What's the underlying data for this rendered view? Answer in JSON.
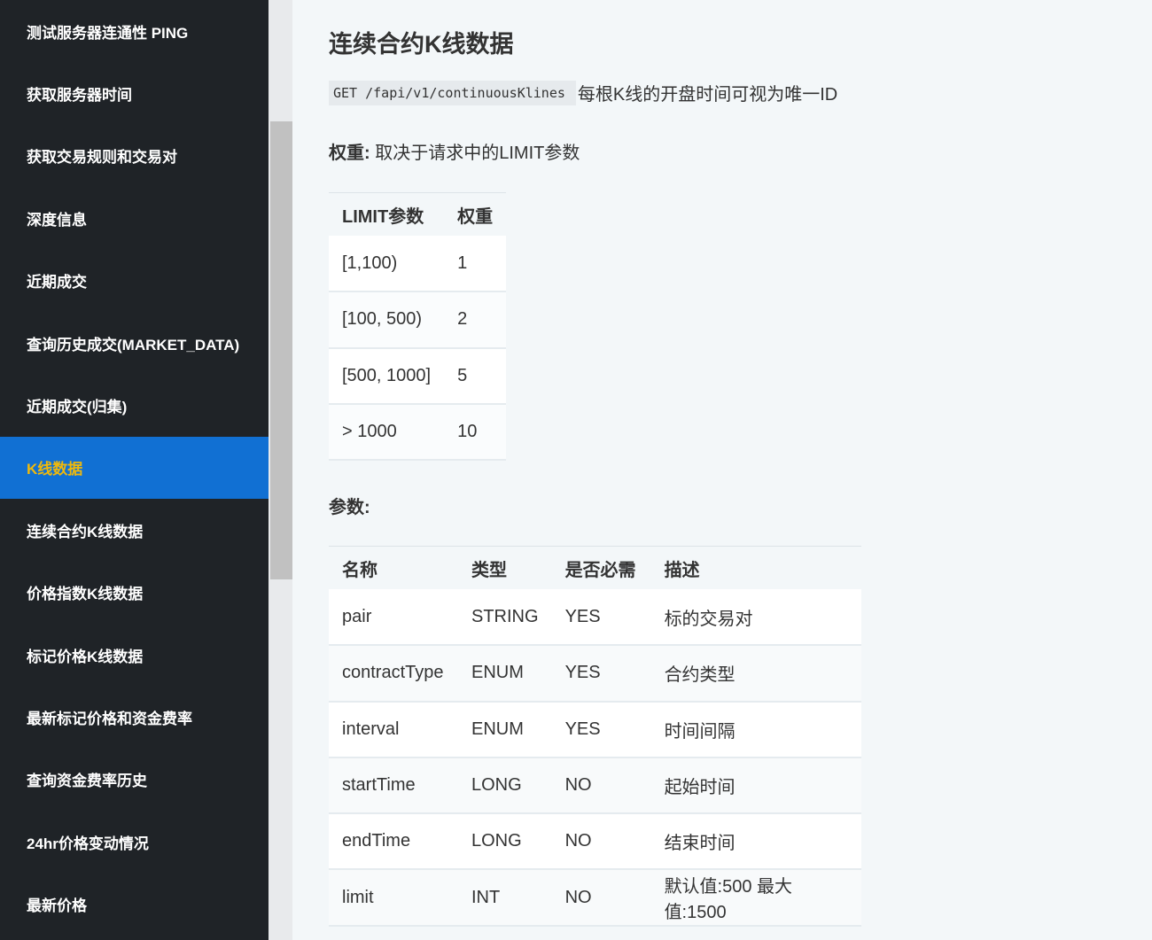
{
  "sidebar": {
    "items": [
      {
        "label": "测试服务器连通性 PING",
        "active": false
      },
      {
        "label": "获取服务器时间",
        "active": false
      },
      {
        "label": "获取交易规则和交易对",
        "active": false
      },
      {
        "label": "深度信息",
        "active": false
      },
      {
        "label": "近期成交",
        "active": false
      },
      {
        "label": "查询历史成交(MARKET_DATA)",
        "active": false
      },
      {
        "label": "近期成交(归集)",
        "active": false
      },
      {
        "label": "K线数据",
        "active": true
      },
      {
        "label": "连续合约K线数据",
        "active": false
      },
      {
        "label": "价格指数K线数据",
        "active": false
      },
      {
        "label": "标记价格K线数据",
        "active": false
      },
      {
        "label": "最新标记价格和资金费率",
        "active": false
      },
      {
        "label": "查询资金费率历史",
        "active": false
      },
      {
        "label": "24hr价格变动情况",
        "active": false
      },
      {
        "label": "最新价格",
        "active": false
      }
    ]
  },
  "main": {
    "title": "连续合约K线数据",
    "endpoint": "GET /fapi/v1/continuousKlines",
    "endpoint_desc": "每根K线的开盘时间可视为唯一ID",
    "weight_label": "权重:",
    "weight_text": " 取决于请求中的LIMIT参数",
    "weight_table": {
      "headers": [
        "LIMIT参数",
        "权重"
      ],
      "rows": [
        [
          "[1,100)",
          "1"
        ],
        [
          "[100, 500)",
          "2"
        ],
        [
          "[500, 1000]",
          "5"
        ],
        [
          "> 1000",
          "10"
        ]
      ]
    },
    "params_heading": "参数:",
    "params_table": {
      "headers": [
        "名称",
        "类型",
        "是否必需",
        "描述"
      ],
      "rows": [
        [
          "pair",
          "STRING",
          "YES",
          "标的交易对"
        ],
        [
          "contractType",
          "ENUM",
          "YES",
          "合约类型"
        ],
        [
          "interval",
          "ENUM",
          "YES",
          "时间间隔"
        ],
        [
          "startTime",
          "LONG",
          "NO",
          "起始时间"
        ],
        [
          "endTime",
          "LONG",
          "NO",
          "结束时间"
        ],
        [
          "limit",
          "INT",
          "NO",
          "默认值:500 最大值:1500"
        ]
      ]
    }
  },
  "colors": {
    "sidebar_bg": "#1f2327",
    "active_bg": "#1170d3",
    "active_text": "#f0b90b",
    "content_bg": "#f3f7f9"
  }
}
